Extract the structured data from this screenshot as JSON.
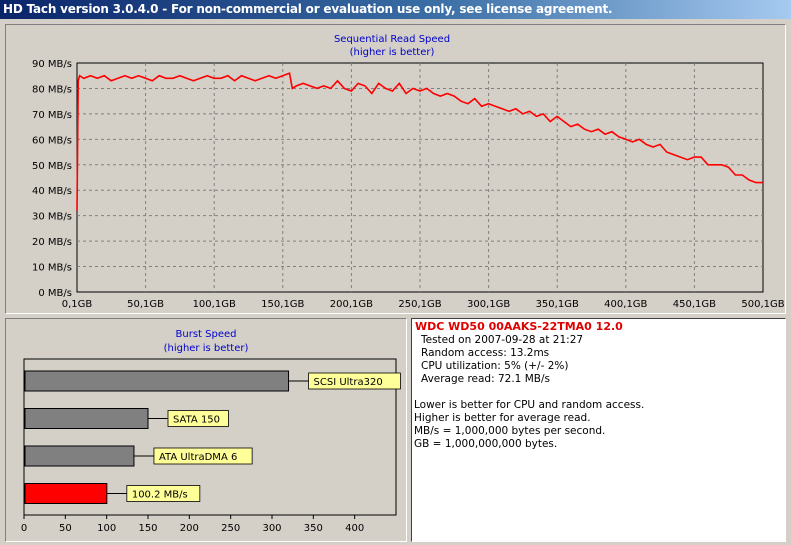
{
  "window": {
    "title": "HD Tach version 3.0.4.0  - For non-commercial or evaluation use only, see license agreement."
  },
  "colors": {
    "titlebar": "#0a246a",
    "read_line": "#ff0000",
    "bar_gray": "#808080",
    "bar_red": "#ff0000",
    "label_bg": "#ffff99",
    "chart_title": "#0000cc",
    "drive_name": "#e00000"
  },
  "info": {
    "drive": "WDC WD50 00AAKS-22TMA0 12.0",
    "tested": "Tested on 2007-09-28 at 21:27",
    "random_access": "Random access: 13.2ms",
    "cpu": "CPU utilization: 5% (+/- 2%)",
    "average_read": "Average read: 72.1 MB/s",
    "note1": "Lower is better for CPU and random access.",
    "note2": "Higher is better for average read.",
    "note3": "MB/s = 1,000,000 bytes per second.",
    "note4": "GB = 1,000,000,000 bytes."
  },
  "chart_data": [
    {
      "type": "line",
      "title": "Sequential Read Speed",
      "subtitle": "(higher is better)",
      "xlim": [
        0.1,
        500.1
      ],
      "ylim": [
        0,
        90
      ],
      "x_ticks": [
        "0,1GB",
        "50,1GB",
        "100,1GB",
        "150,1GB",
        "200,1GB",
        "250,1GB",
        "300,1GB",
        "350,1GB",
        "400,1GB",
        "450,1GB",
        "500,1GB"
      ],
      "y_ticks": [
        "0 MB/s",
        "10 MB/s",
        "20 MB/s",
        "30 MB/s",
        "40 MB/s",
        "50 MB/s",
        "60 MB/s",
        "70 MB/s",
        "80 MB/s",
        "90 MB/s"
      ],
      "grid": true,
      "series": [
        {
          "x": [
            0.1,
            1,
            2,
            5,
            10,
            15,
            20,
            25,
            30,
            35,
            40,
            45,
            50,
            55,
            60,
            65,
            70,
            75,
            80,
            85,
            90,
            95,
            100,
            105,
            110,
            115,
            120,
            125,
            130,
            135,
            140,
            145,
            150,
            155,
            157,
            160,
            165,
            170,
            175,
            180,
            185,
            190,
            195,
            200,
            205,
            210,
            215,
            220,
            225,
            230,
            235,
            240,
            245,
            250,
            255,
            260,
            265,
            270,
            275,
            280,
            285,
            290,
            295,
            300,
            305,
            310,
            315,
            320,
            325,
            330,
            335,
            340,
            345,
            350,
            355,
            360,
            365,
            370,
            375,
            380,
            385,
            390,
            395,
            400,
            405,
            410,
            415,
            420,
            425,
            430,
            435,
            440,
            445,
            450,
            455,
            460,
            465,
            470,
            475,
            480,
            485,
            490,
            495,
            500
          ],
          "y": [
            32,
            83,
            85,
            84,
            85,
            84,
            85,
            83,
            84,
            85,
            84,
            85,
            84,
            83,
            85,
            84,
            84,
            85,
            84,
            83,
            84,
            85,
            84,
            84,
            85,
            83,
            85,
            84,
            83,
            84,
            85,
            84,
            85,
            86,
            80,
            81,
            82,
            81,
            80,
            81,
            80,
            83,
            80,
            79,
            82,
            81,
            78,
            82,
            80,
            79,
            82,
            78,
            80,
            79,
            80,
            78,
            77,
            78,
            77,
            75,
            74,
            76,
            73,
            74,
            73,
            72,
            71,
            72,
            70,
            71,
            69,
            70,
            67,
            69,
            67,
            65,
            66,
            64,
            63,
            64,
            62,
            63,
            61,
            60,
            59,
            60,
            58,
            57,
            58,
            55,
            54,
            53,
            52,
            53,
            53,
            50,
            50,
            50,
            49,
            46,
            46,
            44,
            43,
            43
          ],
          "color": "#ff0000"
        }
      ]
    },
    {
      "type": "bar",
      "orientation": "horizontal",
      "title": "Burst Speed",
      "subtitle": "(higher is better)",
      "xlim": [
        0,
        450
      ],
      "x_ticks": [
        "0",
        "50",
        "100",
        "150",
        "200",
        "250",
        "300",
        "350",
        "400"
      ],
      "categories": [
        "SCSI Ultra320",
        "SATA 150",
        "ATA UltraDMA 6",
        "100.2 MB/s"
      ],
      "values": [
        320,
        150,
        133,
        100.2
      ],
      "bar_colors": [
        "#808080",
        "#808080",
        "#808080",
        "#ff0000"
      ]
    }
  ]
}
